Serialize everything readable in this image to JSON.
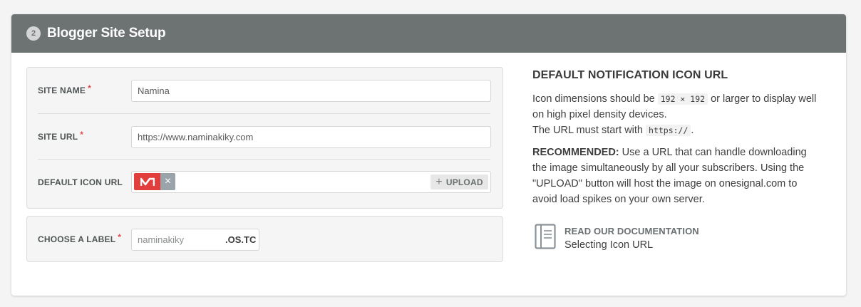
{
  "header": {
    "step_number": "2",
    "title": "Blogger Site Setup"
  },
  "form": {
    "site_name": {
      "label": "SITE NAME",
      "required": "*",
      "value": "Namina"
    },
    "site_url": {
      "label": "SITE URL",
      "required": "*",
      "value": "https://www.naminakiky.com"
    },
    "default_icon_url": {
      "label": "DEFAULT ICON URL",
      "remove_symbol": "×",
      "upload_symbol": "+",
      "upload_label": "UPLOAD"
    },
    "choose_label": {
      "label": "CHOOSE A LABEL",
      "required": "*",
      "placeholder": "naminakiky",
      "suffix": ".OS.TC"
    }
  },
  "help": {
    "title": "DEFAULT NOTIFICATION ICON URL",
    "p1_a": "Icon dimensions should be ",
    "p1_code": "192 × 192",
    "p1_b": " or larger to display well on high pixel density devices.",
    "p1_c": "The URL must start with ",
    "p1_code2": "https://",
    "p1_d": ".",
    "p2_strong": "RECOMMENDED:",
    "p2_text": " Use a URL that can handle downloading the image simultaneously by all your subscribers. Using the \"UPLOAD\" button will host the image on onesignal.com to avoid load spikes on your own server.",
    "doc_title": "READ OUR DOCUMENTATION",
    "doc_link": "Selecting Icon URL"
  },
  "icons": {
    "step_badge": "circle-number-icon",
    "thumb": "onesignal-logo-icon",
    "remove": "close-icon",
    "upload": "plus-icon",
    "doc": "book-icon"
  },
  "colors": {
    "header_bg": "#6d7273",
    "required": "#e54b4d",
    "thumb_bg": "#e23e3b",
    "remove_bg": "#9aa3aa"
  }
}
